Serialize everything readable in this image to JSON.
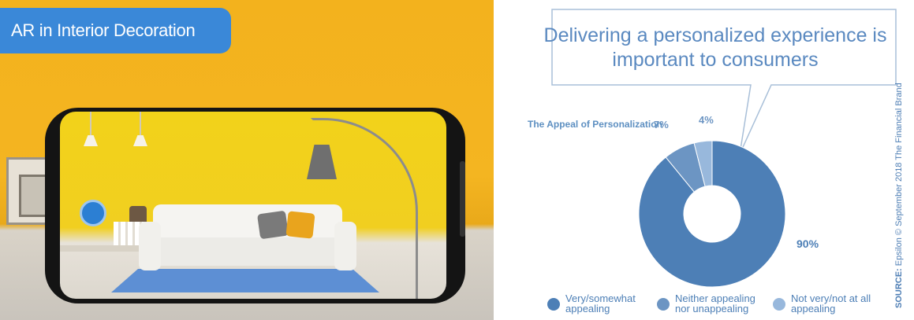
{
  "photo": {
    "title": "AR in Interior Decoration"
  },
  "infographic": {
    "callout_text": "Delivering a personalized experience is important to consumers",
    "source_label": "SOURCE:",
    "source_text": "Epsilon © September 2018 The Financial Brand"
  },
  "colors": {
    "accent_blue": "#3a88d8",
    "pie_dark": "#4d7fb6",
    "pie_mid": "#6c95c3",
    "pie_light": "#98b8dc"
  },
  "chart_data": {
    "type": "pie",
    "title": "The Appeal of Personalization",
    "categories": [
      "Very/somewhat appealing",
      "Neither appealing nor unappealing",
      "Not very/not at all appealing"
    ],
    "values": [
      90,
      7,
      4
    ],
    "data_labels": [
      "90%",
      "7%",
      "4%"
    ],
    "legend_placement": "bottom",
    "donut": true
  }
}
